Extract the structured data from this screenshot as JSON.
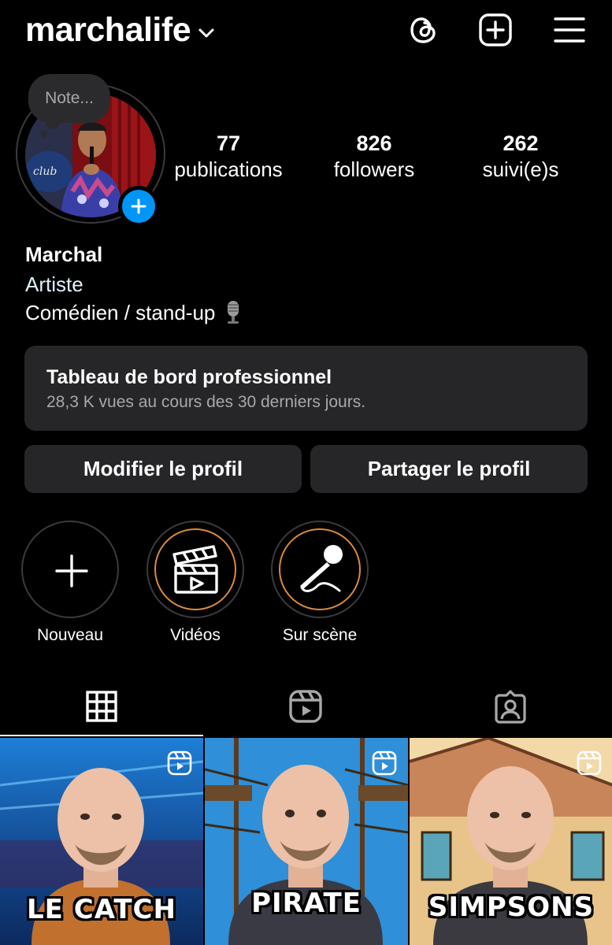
{
  "header": {
    "username": "marchalife",
    "icons": [
      "chevron-down-icon",
      "threads-icon",
      "create-icon",
      "menu-icon"
    ]
  },
  "profile": {
    "note_placeholder": "Note...",
    "stats": [
      {
        "value": "77",
        "label": "publications"
      },
      {
        "value": "826",
        "label": "followers"
      },
      {
        "value": "262",
        "label": "suivi(e)s"
      }
    ],
    "name": "Marchal",
    "category": "Artiste",
    "bio": "Comédien / stand-up",
    "bio_icon": "microphone-emoji"
  },
  "dashboard": {
    "title": "Tableau de bord professionnel",
    "subtitle": "28,3 K vues au cours des 30 derniers jours."
  },
  "actions": {
    "edit_label": "Modifier le profil",
    "share_label": "Partager le profil"
  },
  "highlights": [
    {
      "label": "Nouveau",
      "icon": "plus-icon"
    },
    {
      "label": "Vidéos",
      "icon": "clapperboard-icon"
    },
    {
      "label": "Sur scène",
      "icon": "microphone-icon"
    }
  ],
  "tabs": [
    {
      "name": "posts",
      "icon": "grid-icon",
      "active": true
    },
    {
      "name": "reels",
      "icon": "reels-icon",
      "active": false
    },
    {
      "name": "tagged",
      "icon": "tagged-icon",
      "active": false
    }
  ],
  "posts": [
    {
      "label": "LE CATCH",
      "type": "reel"
    },
    {
      "label": "PIRATE",
      "type": "reel"
    },
    {
      "label": "SIMPSONS",
      "type": "reel"
    }
  ],
  "colors": {
    "background": "#000000",
    "card": "#262628",
    "accent_blue": "#0095f6",
    "highlight_ring": "#d98a3c",
    "category_text": "#e0f1ff",
    "muted_text": "#a8a8a8"
  }
}
